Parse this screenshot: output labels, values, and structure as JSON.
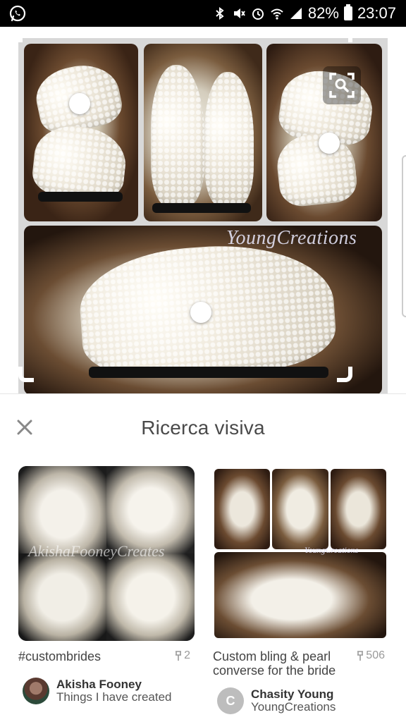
{
  "status_bar": {
    "battery": "82%",
    "time": "23:07",
    "icons": [
      "whatsapp-icon",
      "bluetooth-icon",
      "mute-icon",
      "alarm-icon",
      "wifi-icon",
      "signal-icon",
      "battery-icon"
    ]
  },
  "preview": {
    "watermark": "YoungCreations",
    "visual_search_button": "lens-search-icon"
  },
  "sheet": {
    "close_icon": "close-icon",
    "title": "Ricerca visiva"
  },
  "results": [
    {
      "description": "#custombrides",
      "pins": "2",
      "watermark": "AkishaFooneyCreates",
      "author_name": "Akisha Fooney",
      "author_subtitle": "Things I have created"
    },
    {
      "description": "Custom bling & pearl converse for the bride",
      "pins": "506",
      "watermark": "YoungCreations",
      "author_initial": "C",
      "author_name": "Chasity Young",
      "author_subtitle": "YoungCreations"
    }
  ],
  "colors": {
    "status_bar": "#000000",
    "title_text": "#4a4a4a",
    "pin_count": "#9a9a9a"
  }
}
